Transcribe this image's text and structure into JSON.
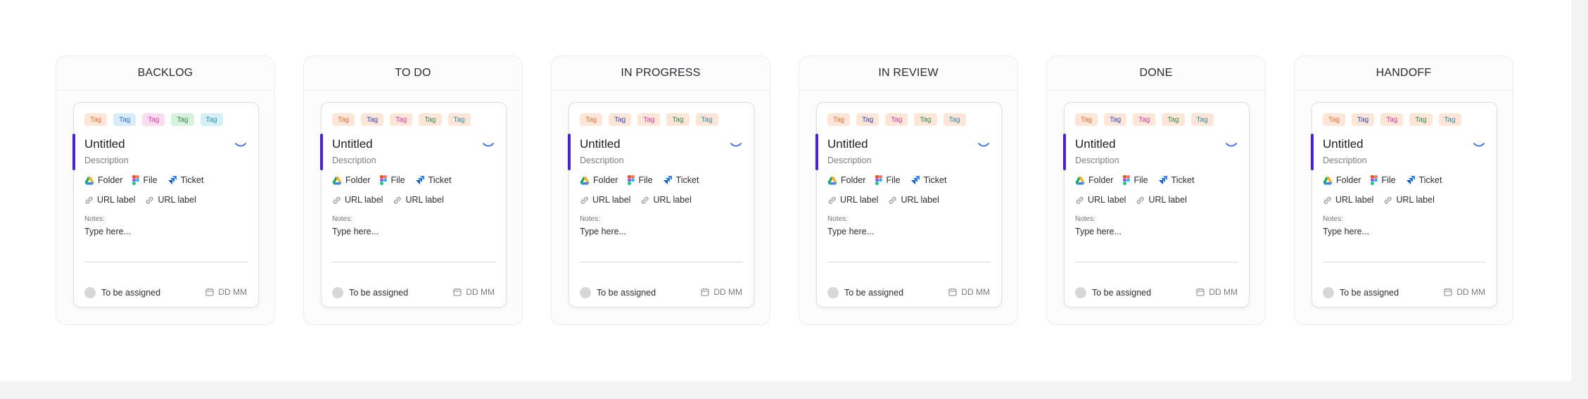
{
  "colors": {
    "accent": "#4a1ee0",
    "chevron": "#3467e8",
    "tag_palette": [
      {
        "bg": "#fde6d8",
        "fg": "#e0733a"
      },
      {
        "bg": "#d9ecfb",
        "fg": "#2f73c9"
      },
      {
        "bg": "#fbdcef",
        "fg": "#d63aa0"
      },
      {
        "bg": "#d6f2dd",
        "fg": "#2e8a4a"
      },
      {
        "bg": "#d4f0f6",
        "fg": "#2f8aa3"
      }
    ],
    "tag_palette_muted": [
      {
        "bg": "#fde6d8",
        "fg": "#e0733a"
      },
      {
        "bg": "#fde6d8",
        "fg": "#3446b8"
      },
      {
        "bg": "#fde6d8",
        "fg": "#d63aa0"
      },
      {
        "bg": "#fde6d8",
        "fg": "#2e8a4a"
      },
      {
        "bg": "#fde6d8",
        "fg": "#2f8aa3"
      }
    ]
  },
  "columns": [
    {
      "title": "BACKLOG"
    },
    {
      "title": "TO DO"
    },
    {
      "title": "IN PROGRESS"
    },
    {
      "title": "IN REVIEW"
    },
    {
      "title": "DONE"
    },
    {
      "title": "HANDOFF"
    }
  ],
  "card": {
    "tags": [
      "Tag",
      "Tag",
      "Tag",
      "Tag",
      "Tag"
    ],
    "title": "Untitled",
    "description": "Description",
    "links": [
      {
        "label": "Folder",
        "icon": "google-drive-icon"
      },
      {
        "label": "File",
        "icon": "figma-icon"
      },
      {
        "label": "Ticket",
        "icon": "jira-icon"
      }
    ],
    "urls": [
      "URL label",
      "URL label"
    ],
    "notes_label": "Notes:",
    "notes_placeholder": "Type here...",
    "assignee": "To be assigned",
    "date": "DD MM"
  }
}
